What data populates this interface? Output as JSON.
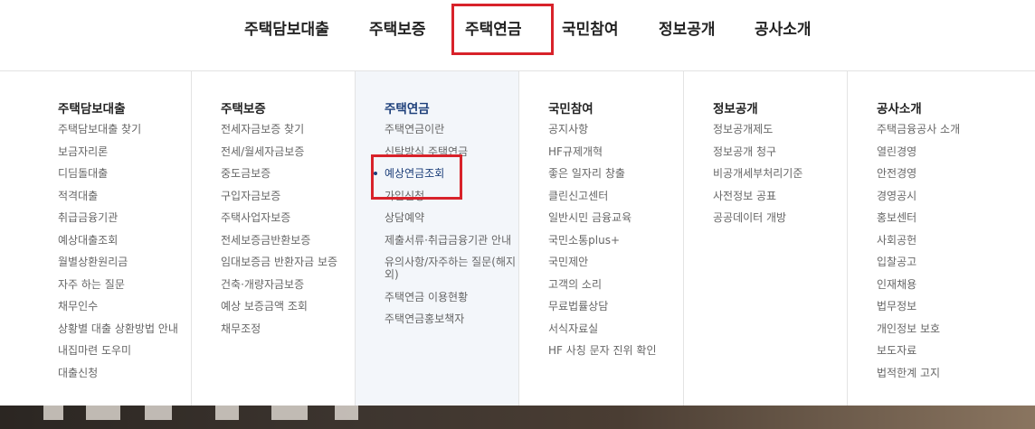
{
  "topnav": {
    "items": [
      "주택담보대출",
      "주택보증",
      "주택연금",
      "국민참여",
      "정보공개",
      "공사소개"
    ]
  },
  "menu": {
    "columns": [
      {
        "title": "주택담보대출",
        "items": [
          "주택담보대출 찾기",
          "보금자리론",
          "디딤돌대출",
          "적격대출",
          "취급금융기관",
          "예상대출조회",
          "월별상환원리금",
          "자주 하는 질문",
          "채무인수",
          "상황별 대출 상환방법 안내",
          "내집마련 도우미",
          "대출신청"
        ]
      },
      {
        "title": "주택보증",
        "items": [
          "전세자금보증 찾기",
          "전세/월세자금보증",
          "중도금보증",
          "구입자금보증",
          "주택사업자보증",
          "전세보증금반환보증",
          "임대보증금 반환자금 보증",
          "건축·개량자금보증",
          "예상 보증금액 조회",
          "채무조정"
        ]
      },
      {
        "title": "주택연금",
        "items": [
          "주택연금이란",
          "신탁방식 주택연금",
          "예상연금조회",
          "가입신청",
          "상담예약",
          "제출서류·취급금융기관 안내",
          "유의사항/자주하는 질문(해지 외)",
          "주택연금 이용현황",
          "주택연금홍보책자"
        ]
      },
      {
        "title": "국민참여",
        "items": [
          "공지사항",
          "HF규제개혁",
          "좋은 일자리 창출",
          "클린신고센터",
          "일반시민 금융교육",
          "국민소통plus+",
          "국민제안",
          "고객의 소리",
          "무료법률상담",
          "서식자료실",
          "HF 사칭 문자 진위 확인"
        ]
      },
      {
        "title": "정보공개",
        "items": [
          "정보공개제도",
          "정보공개 청구",
          "비공개세부처리기준",
          "사전정보 공표",
          "공공데이터 개방"
        ]
      },
      {
        "title": "공사소개",
        "items": [
          "주택금융공사 소개",
          "열린경영",
          "안전경영",
          "경영공시",
          "홍보센터",
          "사회공헌",
          "입찰공고",
          "인재채용",
          "법무정보",
          "개인정보 보호",
          "보도자료",
          "법적한계 고지"
        ]
      }
    ]
  },
  "colors": {
    "highlight": "#d8222a",
    "active_title": "#1d3f7a",
    "active_bg": "#f3f6fa"
  }
}
